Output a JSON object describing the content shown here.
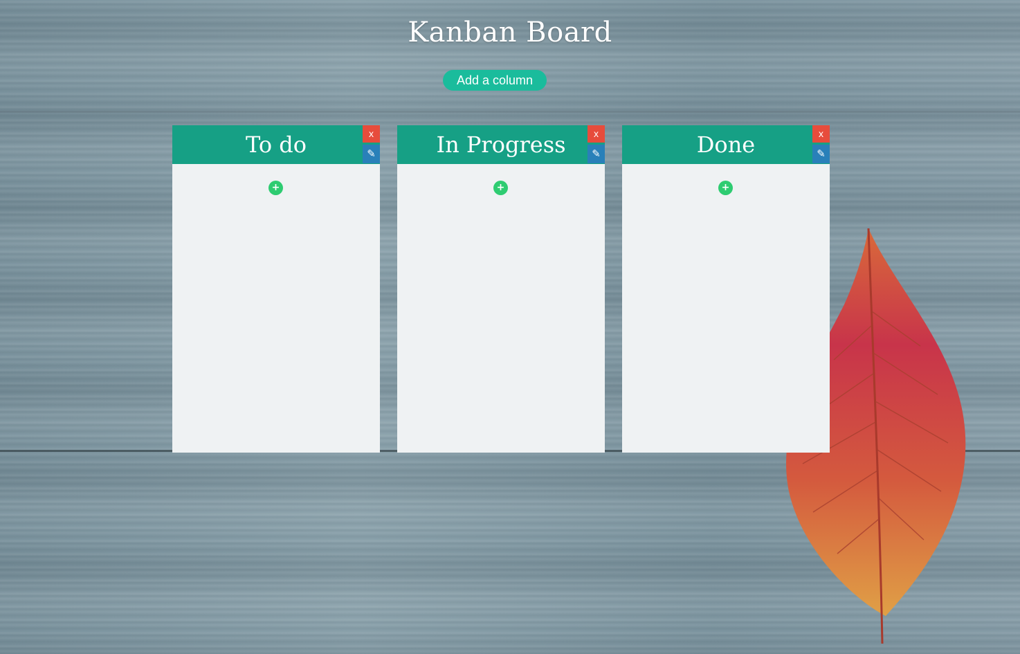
{
  "page": {
    "title": "Kanban Board",
    "add_column_label": "Add a column"
  },
  "columns": [
    {
      "title": "To do",
      "delete_label": "x",
      "edit_icon": "✎",
      "add_card_label": "+"
    },
    {
      "title": "In Progress",
      "delete_label": "x",
      "edit_icon": "✎",
      "add_card_label": "+"
    },
    {
      "title": "Done",
      "delete_label": "x",
      "edit_icon": "✎",
      "add_card_label": "+"
    }
  ],
  "colors": {
    "header": "#16a085",
    "add_column_button": "#1abc9c",
    "delete_button": "#e74c3c",
    "edit_button": "#2980b9",
    "add_card_button": "#2ecc71",
    "column_body": "#eff2f3"
  },
  "icons": {
    "delete": "close-icon",
    "edit": "pencil-icon",
    "add_card": "plus-icon"
  }
}
